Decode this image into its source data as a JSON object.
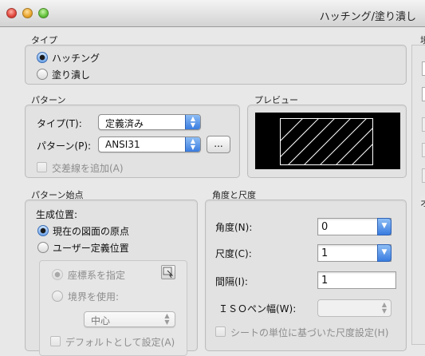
{
  "window": {
    "title": "ハッチング/塗り潰し"
  },
  "type_section": {
    "title": "タイプ",
    "options": [
      "ハッチング",
      "塗り潰し"
    ],
    "selected_index": 0
  },
  "pattern_section": {
    "title": "パターン",
    "type_label": "タイプ(T):",
    "type_value": "定義済み",
    "pattern_label": "パターン(P):",
    "pattern_value": "ANSI31",
    "browse_label": "...",
    "crosshatch_label": "交差線を追加(A)"
  },
  "preview_section": {
    "title": "プレビュー"
  },
  "origin_section": {
    "title": "パターン始点",
    "generate_label": "生成位置:",
    "options": [
      "現在の図面の原点",
      "ユーザー定義位置"
    ],
    "selected_index": 0,
    "sub_options": [
      "座標系を指定",
      "境界を使用:"
    ],
    "sub_selected_index": 0,
    "boundary_value": "中心",
    "default_label": "デフォルトとして設定(A)"
  },
  "angle_scale_section": {
    "title": "角度と尺度",
    "angle_label": "角度(N):",
    "angle_value": "0",
    "scale_label": "尺度(C):",
    "scale_value": "1",
    "spacing_label": "間隔(I):",
    "spacing_value": "1",
    "iso_label": "ＩＳＯペン幅(W):",
    "iso_value": "",
    "sheet_units_label": "シートの単位に基づいた尺度設定(H)"
  },
  "right_column": {
    "top_title_fragment": "境",
    "bottom_title_fragment": "オ"
  }
}
